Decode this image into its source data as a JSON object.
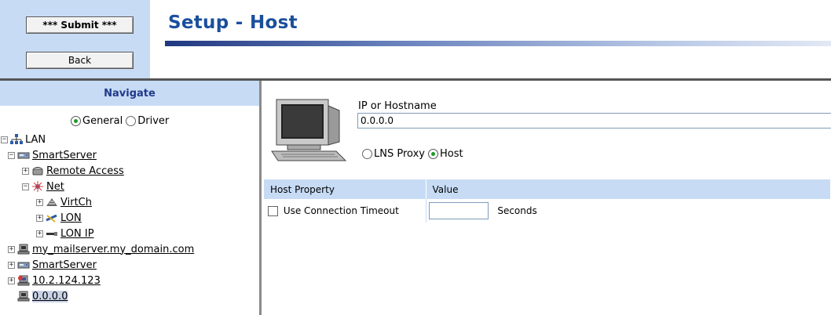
{
  "toolbar": {
    "submit_label": "*** Submit ***",
    "back_label": "Back"
  },
  "page": {
    "title": "Setup - Host"
  },
  "nav": {
    "title": "Navigate",
    "radio_general": "General",
    "radio_driver": "Driver",
    "selected_mode": "General",
    "tree": {
      "lan": "LAN",
      "smartserver_1": "SmartServer",
      "remote_access": "Remote Access",
      "net": "Net",
      "virtch": "VirtCh",
      "lon": "LON",
      "lon_ip": "LON IP",
      "mailserver": "my_mailserver.my_domain.com",
      "smartserver_2": "SmartServer",
      "ip_host": "10.2.124.123",
      "selected_host": "0.0.0.0"
    },
    "icons": {
      "lan": "network-icon",
      "smartserver": "server-icon",
      "remote_access": "phone-icon",
      "net": "net-icon",
      "virtch": "channel-icon",
      "lon": "lon-icon",
      "lon_ip": "lonip-icon",
      "host": "host-icon"
    }
  },
  "host": {
    "ip_label": "IP or Hostname",
    "ip_value": "0.0.0.0",
    "radio_lns_proxy": "LNS Proxy",
    "radio_host": "Host",
    "selected_type": "Host"
  },
  "props": {
    "header_property": "Host Property",
    "header_value": "Value",
    "rows": [
      {
        "name": "Use Connection Timeout",
        "checked": false,
        "value": "",
        "unit": "Seconds"
      }
    ]
  },
  "colors": {
    "accent": "#1a4f9c",
    "panel": "#c7dbf5",
    "radio_dot": "#1d9a2a"
  }
}
